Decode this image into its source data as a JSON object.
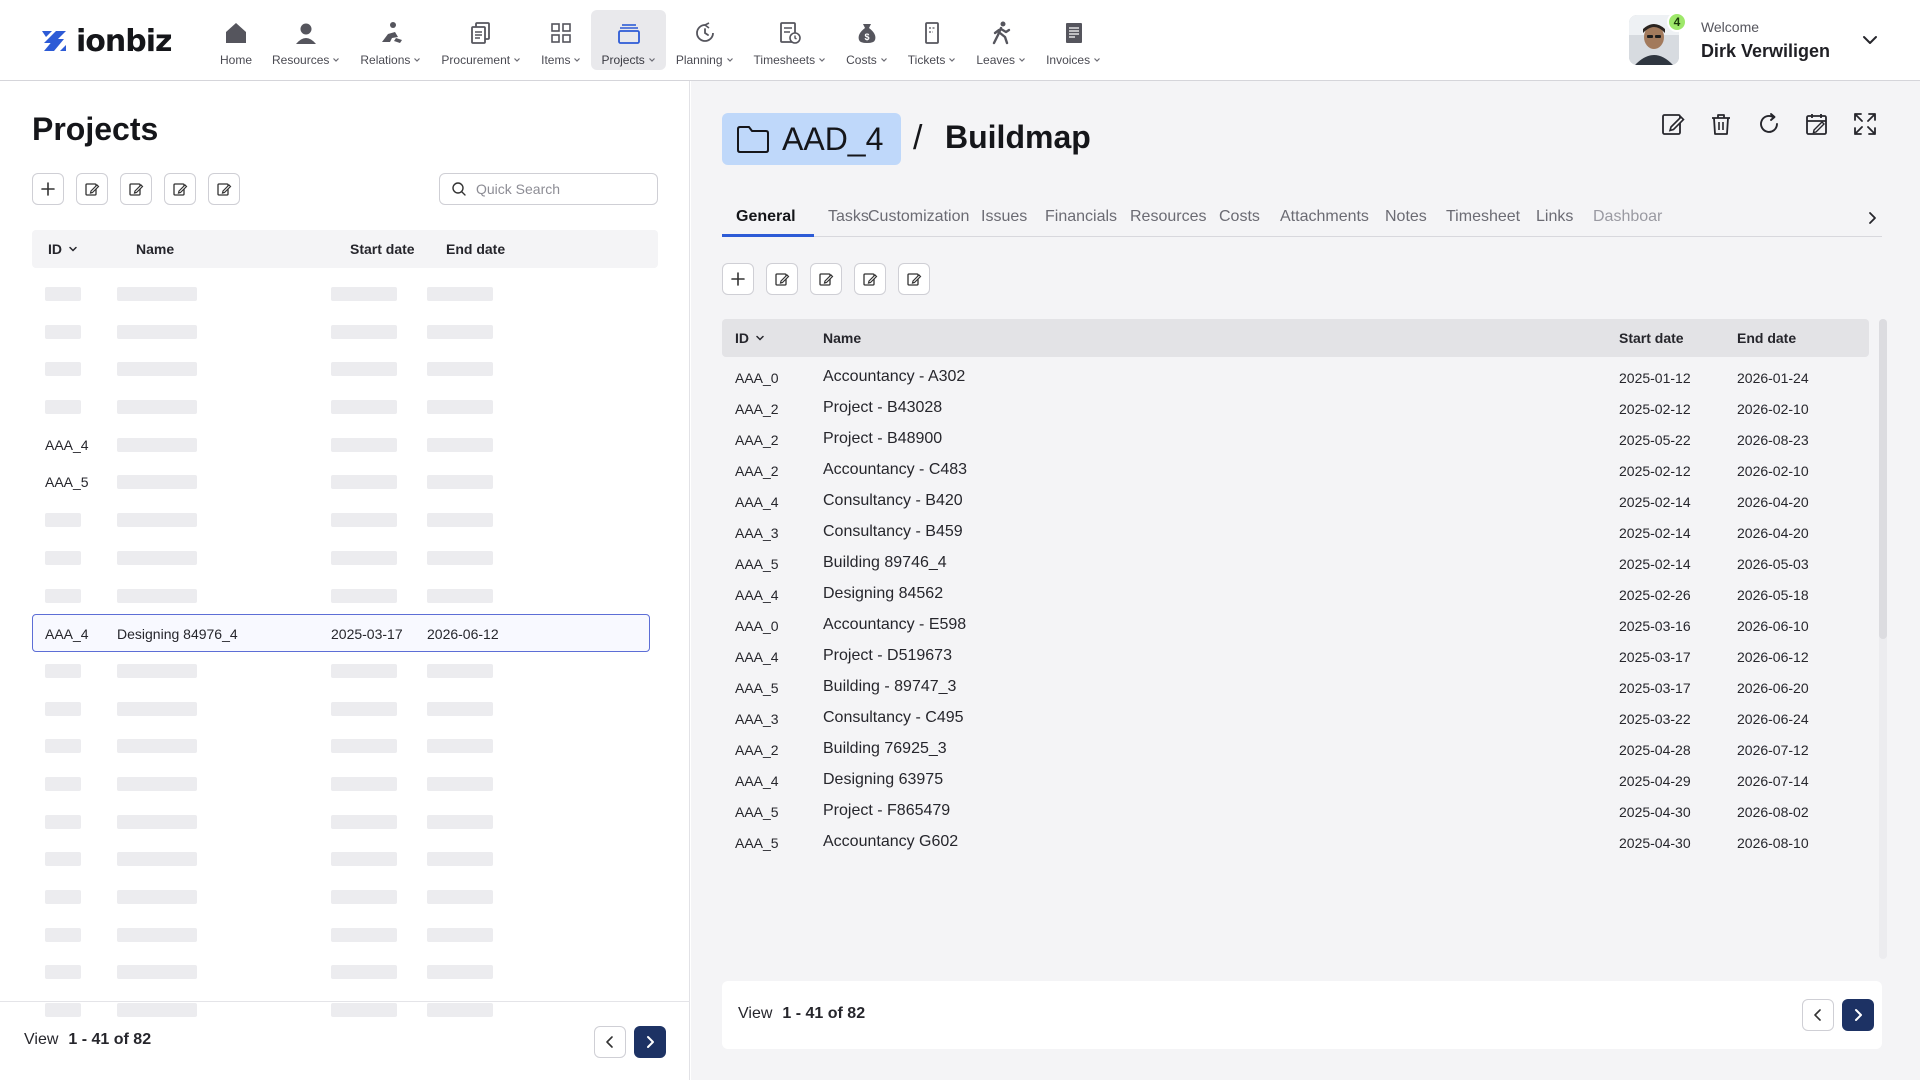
{
  "app": {
    "logo_text": "ionbiz",
    "brand_color": "#2d5bd6"
  },
  "nav": [
    {
      "label": "Home",
      "icon": "home-icon",
      "has_caret": false,
      "active": false
    },
    {
      "label": "Resources",
      "icon": "user-icon",
      "has_caret": true,
      "active": false
    },
    {
      "label": "Relations",
      "icon": "handshake-icon",
      "has_caret": true,
      "active": false
    },
    {
      "label": "Procurement",
      "icon": "receipt-icon",
      "has_caret": true,
      "active": false
    },
    {
      "label": "Items",
      "icon": "grid-icon",
      "has_caret": true,
      "active": false
    },
    {
      "label": "Projects",
      "icon": "folders-icon",
      "has_caret": true,
      "active": true
    },
    {
      "label": "Planning",
      "icon": "clock-arrow-icon",
      "has_caret": true,
      "active": false
    },
    {
      "label": "Timesheets",
      "icon": "timesheet-icon",
      "has_caret": true,
      "active": false
    },
    {
      "label": "Costs",
      "icon": "money-bag-icon",
      "has_caret": true,
      "active": false
    },
    {
      "label": "Tickets",
      "icon": "ticket-icon",
      "has_caret": true,
      "active": false
    },
    {
      "label": "Leaves",
      "icon": "walking-icon",
      "has_caret": true,
      "active": false
    },
    {
      "label": "Invoices",
      "icon": "invoice-icon",
      "has_caret": true,
      "active": false
    }
  ],
  "user": {
    "welcome": "Welcome",
    "name": "Dirk Verwiligen",
    "notification_count": "4"
  },
  "left_panel": {
    "title": "Projects",
    "search_placeholder": "Quick Search",
    "columns": {
      "id": "ID",
      "name": "Name",
      "start": "Start date",
      "end": "End date"
    },
    "rows": [
      {
        "id": "",
        "name": "",
        "start": "",
        "end": "",
        "loaded": false
      },
      {
        "id": "",
        "name": "",
        "start": "",
        "end": "",
        "loaded": false
      },
      {
        "id": "",
        "name": "",
        "start": "",
        "end": "",
        "loaded": false
      },
      {
        "id": "",
        "name": "",
        "start": "",
        "end": "",
        "loaded": false
      },
      {
        "id": "AAA_4",
        "name": "",
        "start": "",
        "end": "",
        "loaded": "partial"
      },
      {
        "id": "AAA_5",
        "name": "",
        "start": "",
        "end": "",
        "loaded": "partial"
      },
      {
        "id": "",
        "name": "",
        "start": "",
        "end": "",
        "loaded": false
      },
      {
        "id": "",
        "name": "",
        "start": "",
        "end": "",
        "loaded": false
      },
      {
        "id": "",
        "name": "",
        "start": "",
        "end": "",
        "loaded": false
      },
      {
        "id": "AAA_4",
        "name": "Designing 84976_4",
        "start": "2025-03-17",
        "end": "2026-06-12",
        "loaded": true,
        "selected": true
      },
      {
        "id": "",
        "name": "",
        "start": "",
        "end": "",
        "loaded": false
      },
      {
        "id": "",
        "name": "",
        "start": "",
        "end": "",
        "loaded": false
      },
      {
        "id": "",
        "name": "",
        "start": "",
        "end": "",
        "loaded": false
      },
      {
        "id": "",
        "name": "",
        "start": "",
        "end": "",
        "loaded": false
      },
      {
        "id": "",
        "name": "",
        "start": "",
        "end": "",
        "loaded": false
      },
      {
        "id": "",
        "name": "",
        "start": "",
        "end": "",
        "loaded": false
      },
      {
        "id": "",
        "name": "",
        "start": "",
        "end": "",
        "loaded": false
      },
      {
        "id": "",
        "name": "",
        "start": "",
        "end": "",
        "loaded": false
      },
      {
        "id": "",
        "name": "",
        "start": "",
        "end": "",
        "loaded": false
      },
      {
        "id": "",
        "name": "",
        "start": "",
        "end": "",
        "loaded": false
      }
    ],
    "footer": {
      "view_label": "View",
      "range": "1 - 41 of 82"
    }
  },
  "right_panel": {
    "project_code": "AAD_4",
    "separator": "/",
    "project_title": "Buildmap",
    "tabs": [
      "General",
      "Tasks",
      "Customization",
      "Issues",
      "Financials",
      "Resources",
      "Costs",
      "Attachments",
      "Notes",
      "Timesheet",
      "Links",
      "Dashboar"
    ],
    "active_tab": "General",
    "columns": {
      "id": "ID",
      "name": "Name",
      "start": "Start date",
      "end": "End date"
    },
    "rows": [
      {
        "id": "AAA_0",
        "name": "Accountancy - A302",
        "start": "2025-01-12",
        "end": "2026-01-24"
      },
      {
        "id": "AAA_2",
        "name": "Project - B43028",
        "start": "2025-02-12",
        "end": "2026-02-10"
      },
      {
        "id": "AAA_2",
        "name": "Project - B48900",
        "start": "2025-05-22",
        "end": "2026-08-23"
      },
      {
        "id": "AAA_2",
        "name": "Accountancy - C483",
        "start": "2025-02-12",
        "end": "2026-02-10"
      },
      {
        "id": "AAA_4",
        "name": "Consultancy - B420",
        "start": "2025-02-14",
        "end": "2026-04-20"
      },
      {
        "id": "AAA_3",
        "name": "Consultancy - B459",
        "start": "2025-02-14",
        "end": "2026-04-20"
      },
      {
        "id": "AAA_5",
        "name": "Building 89746_4",
        "start": "2025-02-14",
        "end": "2026-05-03"
      },
      {
        "id": "AAA_4",
        "name": "Designing 84562",
        "start": "2025-02-26",
        "end": "2026-05-18"
      },
      {
        "id": "AAA_0",
        "name": "Accountancy - E598",
        "start": "2025-03-16",
        "end": "2026-06-10"
      },
      {
        "id": "AAA_4",
        "name": "Project - D519673",
        "start": "2025-03-17",
        "end": "2026-06-12"
      },
      {
        "id": "AAA_5",
        "name": "Building - 89747_3",
        "start": "2025-03-17",
        "end": "2026-06-20"
      },
      {
        "id": "AAA_3",
        "name": "Consultancy - C495",
        "start": "2025-03-22",
        "end": "2026-06-24"
      },
      {
        "id": "AAA_2",
        "name": "Building 76925_3",
        "start": "2025-04-28",
        "end": "2026-07-12"
      },
      {
        "id": "AAA_4",
        "name": "Designing 63975",
        "start": "2025-04-29",
        "end": "2026-07-14"
      },
      {
        "id": "AAA_5",
        "name": "Project - F865479",
        "start": "2025-04-30",
        "end": "2026-08-02"
      },
      {
        "id": "AAA_5",
        "name": "Accountancy G602",
        "start": "2025-04-30",
        "end": "2026-08-10"
      }
    ],
    "footer": {
      "view_label": "View",
      "range": "1 - 41 of 82"
    }
  }
}
